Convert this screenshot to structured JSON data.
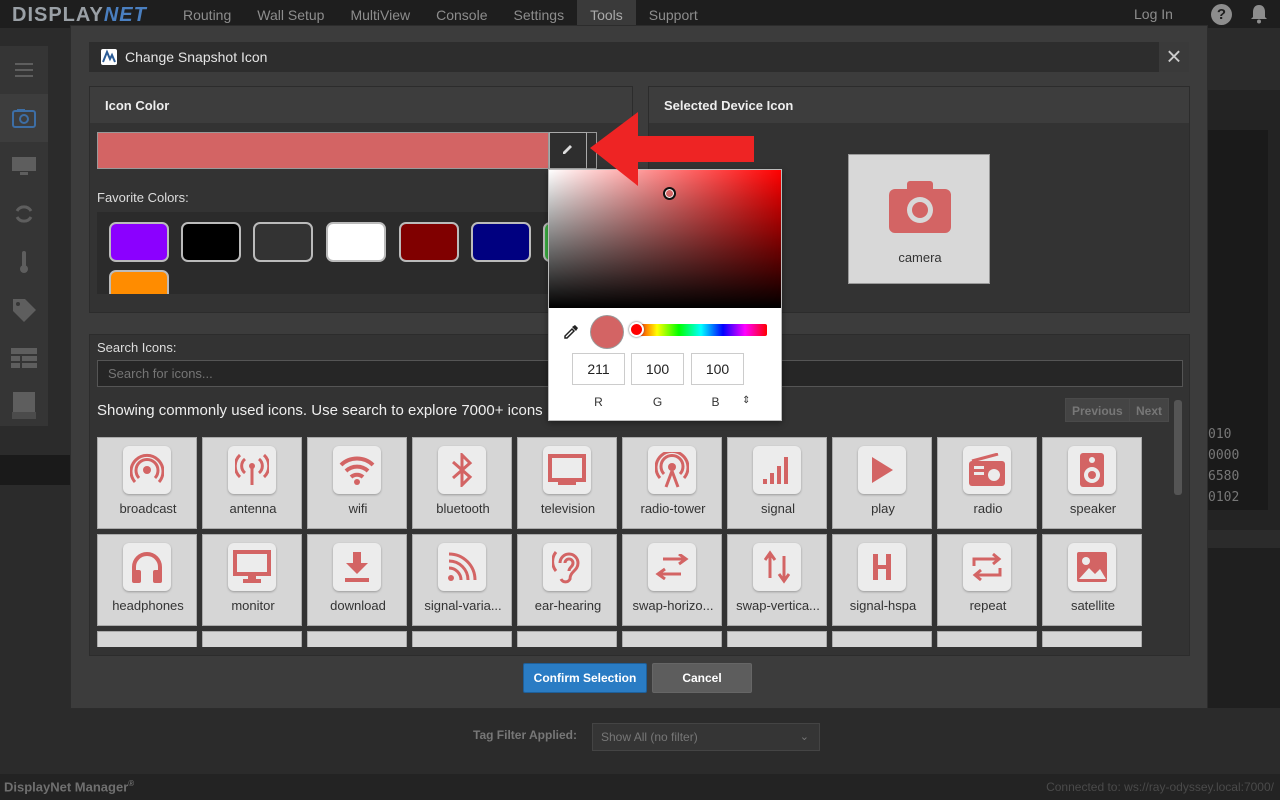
{
  "nav": {
    "logo_display": "DISPLAY",
    "logo_net": "NET",
    "items": [
      "Routing",
      "Wall Setup",
      "MultiView",
      "Console",
      "Settings",
      "Tools",
      "Support"
    ],
    "active": "Tools",
    "login": "Log In",
    "help": "?"
  },
  "sidebar": {
    "icons": [
      "menu-icon",
      "snapshot-icon",
      "edid-icon",
      "refresh-icon",
      "thermometer-icon",
      "tag-icon",
      "table-icon",
      "log-icon"
    ]
  },
  "background": {
    "code_lines": [
      "010",
      "0000",
      "6580",
      "0102"
    ],
    "tag_filter_label": "Tag Filter Applied:",
    "tag_filter_value": "Show All (no filter)",
    "footer_brand": "DisplayNet Manager",
    "footer_brand_mark": "®",
    "footer_connection": "Connected to: ws://ray-odyssey.local:7000/"
  },
  "modal": {
    "title": "Change Snapshot Icon",
    "icon_color_header": "Icon Color",
    "selected_icon_header": "Selected Device Icon",
    "current_color": "#d36464",
    "favorite_colors_label": "Favorite Colors:",
    "favorite_colors": [
      "#8b00ff",
      "#000000",
      "#333333",
      "#ffffff",
      "#800000",
      "#000080",
      "#3cb043",
      "#ff8c00"
    ],
    "selected_icon_label": "camera",
    "search_label": "Search Icons:",
    "search_placeholder": "Search for icons...",
    "showing_text": "Showing commonly used icons. Use search to explore 7000+ icons",
    "previous": "Previous",
    "next": "Next",
    "icons": [
      {
        "name": "broadcast",
        "icon": "broadcast-icon"
      },
      {
        "name": "antenna",
        "icon": "antenna-icon"
      },
      {
        "name": "wifi",
        "icon": "wifi-icon"
      },
      {
        "name": "bluetooth",
        "icon": "bluetooth-icon"
      },
      {
        "name": "television",
        "icon": "television-icon"
      },
      {
        "name": "radio-tower",
        "icon": "radio-tower-icon"
      },
      {
        "name": "signal",
        "icon": "signal-icon"
      },
      {
        "name": "play",
        "icon": "play-icon"
      },
      {
        "name": "radio",
        "icon": "radio-icon"
      },
      {
        "name": "speaker",
        "icon": "speaker-icon"
      },
      {
        "name": "headphones",
        "icon": "headphones-icon"
      },
      {
        "name": "monitor",
        "icon": "monitor-icon"
      },
      {
        "name": "download",
        "icon": "download-icon"
      },
      {
        "name": "signal-varia...",
        "icon": "signal-variant-icon"
      },
      {
        "name": "ear-hearing",
        "icon": "ear-hearing-icon"
      },
      {
        "name": "swap-horizo...",
        "icon": "swap-horizontal-icon"
      },
      {
        "name": "swap-vertica...",
        "icon": "swap-vertical-icon"
      },
      {
        "name": "signal-hspa",
        "icon": "signal-hspa-icon"
      },
      {
        "name": "repeat",
        "icon": "repeat-icon"
      },
      {
        "name": "satellite",
        "icon": "satellite-icon"
      }
    ],
    "confirm": "Confirm Selection",
    "cancel": "Cancel",
    "accent_color": "#d36464"
  },
  "picker": {
    "r": "211",
    "g": "100",
    "b": "100",
    "r_label": "R",
    "g_label": "G",
    "b_label": "B",
    "hue_color": "#ff0000"
  }
}
